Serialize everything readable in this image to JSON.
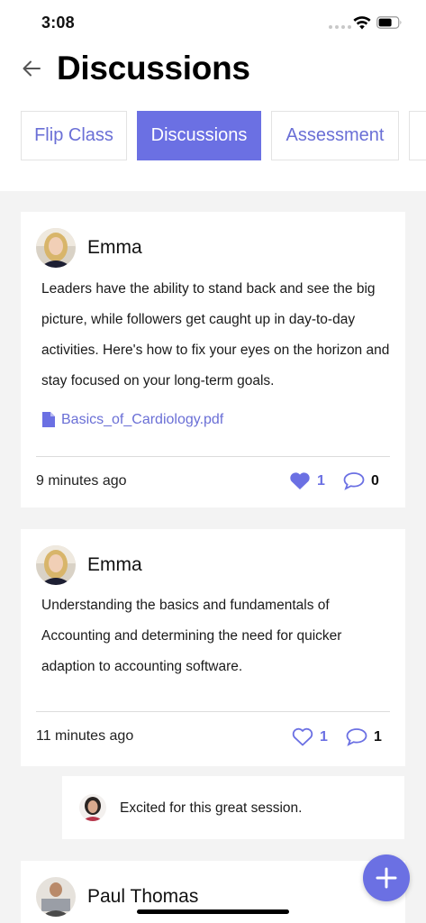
{
  "status": {
    "time": "3:08"
  },
  "header": {
    "title": "Discussions"
  },
  "tabs": [
    {
      "label": "Flip Class"
    },
    {
      "label": "Discussions",
      "active": true
    },
    {
      "label": "Assessment"
    }
  ],
  "posts": [
    {
      "author": "Emma",
      "body": "Leaders have the ability to stand back and see the big picture, while followers get caught up in day-to-day activities. Here's how to fix your eyes on the horizon and stay focused on your long-term goals.",
      "attachment": "Basics_of_Cardiology.pdf",
      "time_ago": "9 minutes ago",
      "likes": "1",
      "comments": "0",
      "liked": true
    },
    {
      "author": "Emma",
      "body": "Understanding the basics and fundamentals of Accounting and determining the need for quicker adaption to accounting software.",
      "time_ago": "11 minutes ago",
      "likes": "1",
      "comments": "1",
      "liked": false
    },
    {
      "author": "Paul Thomas"
    }
  ],
  "reply": {
    "text": "Excited for this great session."
  },
  "colors": {
    "accent": "#6b70e3",
    "background": "#f3f3f3"
  }
}
